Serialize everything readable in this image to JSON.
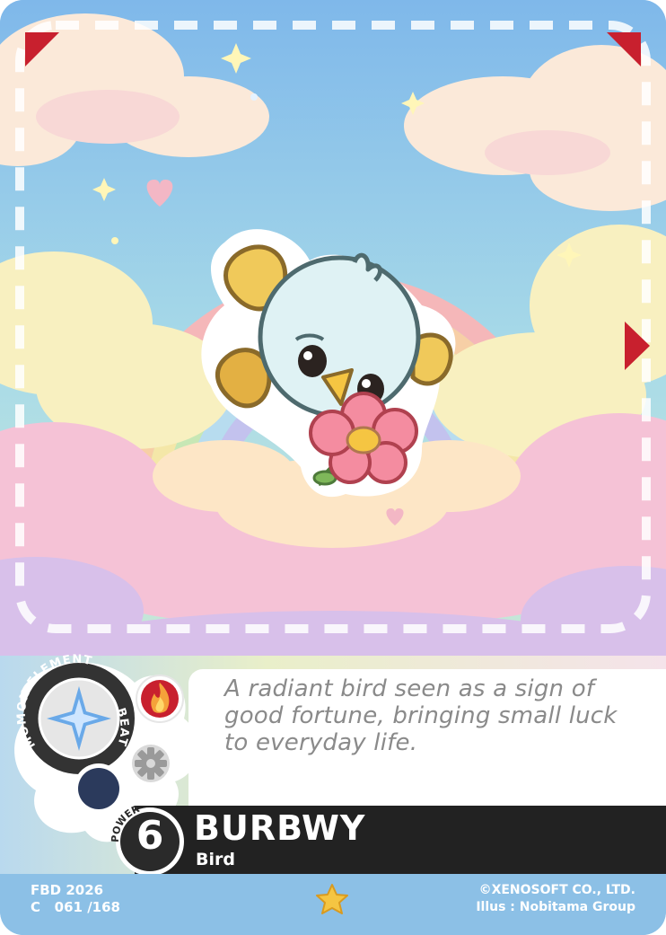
{
  "card": {
    "name": "BURBWY",
    "type": "Bird",
    "power_label": "POWER",
    "power": "6",
    "element_label_top": "MOMON ELEMENT",
    "element_label_side": "BEAT",
    "flavor_text": "A radiant bird seen as a sign of good fortune, bringing small luck to everyday life.",
    "set_line1": "FBD 2026",
    "set_line2": "C   061 /168",
    "copyright": "©XENOSOFT CO., LTD.",
    "illustrator": "Illus : Nobitama Group"
  },
  "icons": {
    "main_element": "compass-star-icon",
    "fire": "fire-icon",
    "gear": "gear-icon",
    "moon": "crescent-moon-icon",
    "rarity": "star-icon",
    "corner_markers": "triangle-corner-icon",
    "side_marker": "play-triangle-icon"
  },
  "colors": {
    "accent_red": "#c8202e",
    "name_bar": "#222222",
    "bottom_bar": "#8cc0e6",
    "flavor_text": "#8a8a8a",
    "rarity_star": "#f5c542"
  }
}
